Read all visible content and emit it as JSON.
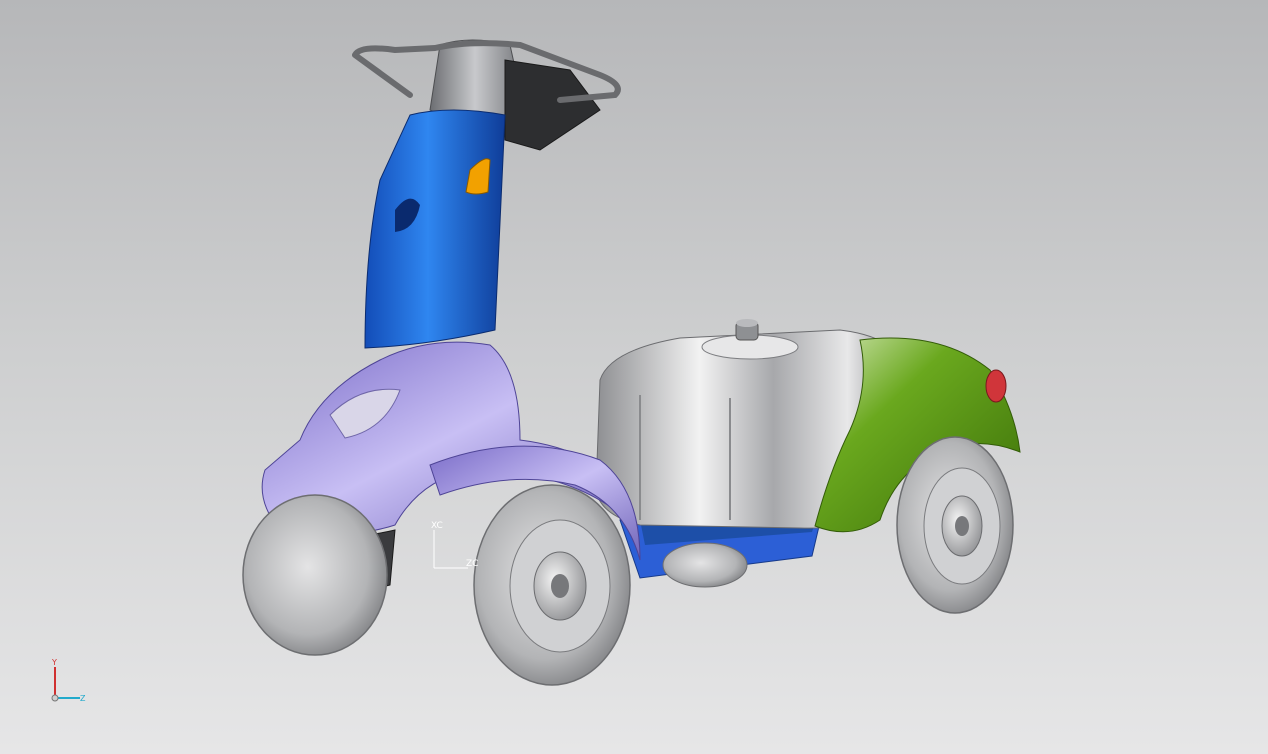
{
  "viewport": {
    "background_top": "#b6b7b9",
    "background_bottom": "#e6e6e7"
  },
  "model": {
    "subject": "mobility-scooter",
    "colors": {
      "tiller_blue": "#1f6fe0",
      "tiller_grey": "#8a8c90",
      "front_shroud_lavender": "#9a8ee0",
      "battery_box_silver": "#c9cacc",
      "rear_fender_green": "#4e8a10",
      "frame_blue": "#2c5fd6",
      "tire_grey": "#b9babc",
      "indicator_orange": "#f2a100",
      "tail_light_red": "#d0353a"
    }
  },
  "wcs_triad": {
    "y_label": "Y",
    "z_label": "Z",
    "x_color": "#d03030",
    "y_color": "#d03030",
    "z_color": "#22aacc"
  },
  "wcs_label_xc": "XC",
  "wcs_label_zc": "ZC"
}
